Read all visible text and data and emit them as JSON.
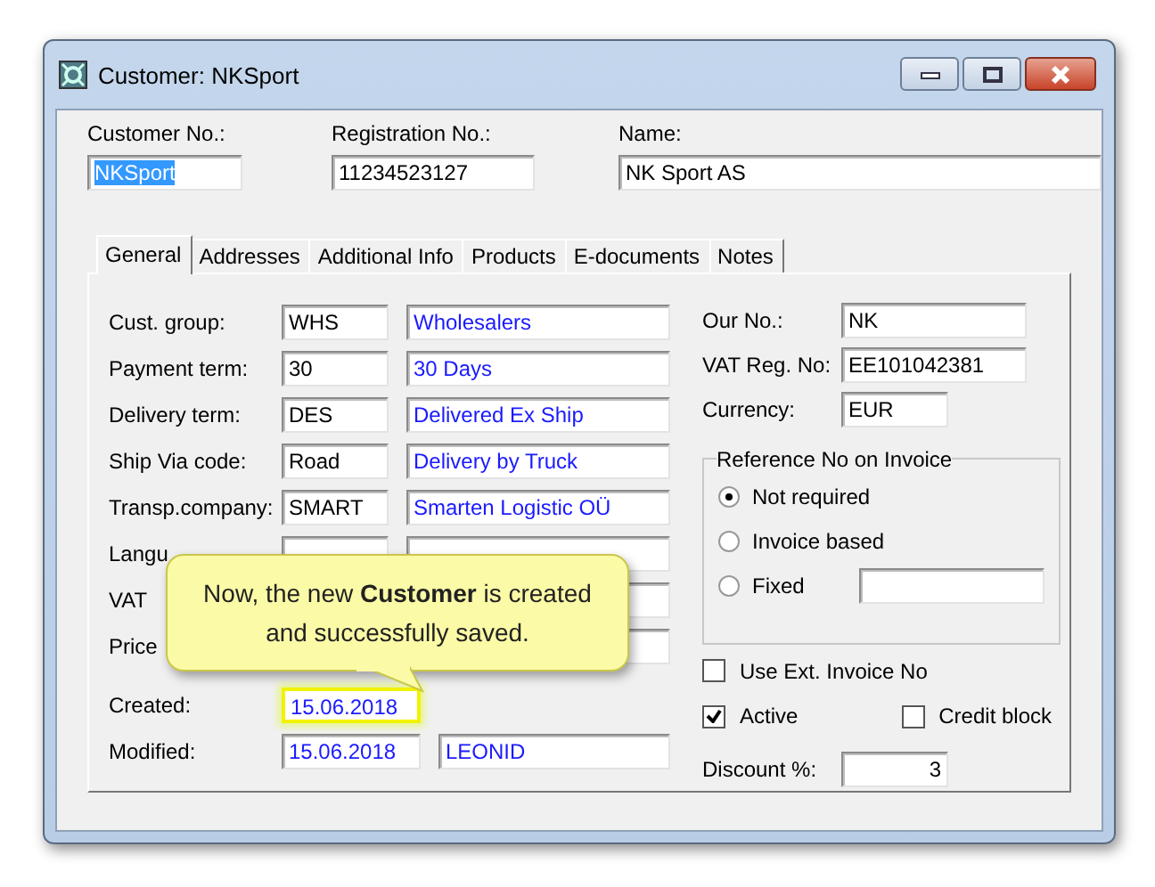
{
  "window": {
    "title": "Customer: NKSport"
  },
  "header": [
    {
      "label": "Customer No.:",
      "value": "NKSport",
      "highlighted": true
    },
    {
      "label": "Registration No.:",
      "value": "11234523127",
      "highlighted": false
    },
    {
      "label": "Name:",
      "value": "NK Sport AS",
      "highlighted": false
    }
  ],
  "tabs": [
    {
      "label": "General",
      "selected": true
    },
    {
      "label": "Addresses",
      "selected": false
    },
    {
      "label": "Additional Info",
      "selected": false
    },
    {
      "label": "Products",
      "selected": false
    },
    {
      "label": "E-documents",
      "selected": false
    },
    {
      "label": "Notes",
      "selected": false
    }
  ],
  "left_rows": [
    {
      "kind": "lookup",
      "label": "Cust. group:",
      "code": "WHS",
      "description": "Wholesalers"
    },
    {
      "kind": "lookup",
      "label": "Payment term:",
      "code": "30",
      "description": "30 Days"
    },
    {
      "kind": "lookup",
      "label": "Delivery term:",
      "code": "DES",
      "description": "Delivered Ex Ship"
    },
    {
      "kind": "lookup",
      "label": "Ship Via code:",
      "code": "Road",
      "description": "Delivery by Truck"
    },
    {
      "kind": "lookup",
      "label": "Transp.company:",
      "code": "SMART",
      "description": "Smarten Logistic OÜ"
    },
    {
      "kind": "covered",
      "label": "Langu"
    },
    {
      "kind": "covered",
      "label": "VAT"
    },
    {
      "kind": "covered",
      "label": "Price"
    },
    {
      "kind": "stamp",
      "label": "Created:",
      "code": "15.06.2018",
      "highlighted": true
    },
    {
      "kind": "stamp",
      "label": "Modified:",
      "code": "15.06.2018",
      "description": "LEONID",
      "highlighted": false
    }
  ],
  "right_fields": [
    {
      "kind": "long",
      "label": "Our No.:",
      "value": "NK"
    },
    {
      "kind": "long",
      "label": "VAT Reg. No:",
      "value": "EE101042381"
    },
    {
      "kind": "short",
      "label": "Currency:",
      "value": "EUR"
    }
  ],
  "reference_group": {
    "title": "Reference No on Invoice",
    "options": [
      {
        "label": "Not required",
        "selected": true
      },
      {
        "label": "Invoice based",
        "selected": false
      },
      {
        "label": "Fixed",
        "selected": false
      }
    ]
  },
  "checkboxes": [
    {
      "label": "Use Ext. Invoice No",
      "checked": false
    },
    {
      "label": "Active",
      "checked": true
    },
    {
      "label": "Credit block",
      "checked": false
    }
  ],
  "discount": {
    "label": "Discount %:",
    "value": "3"
  },
  "callout": {
    "text": "Now, the new **Customer** is created and successfully saved."
  }
}
